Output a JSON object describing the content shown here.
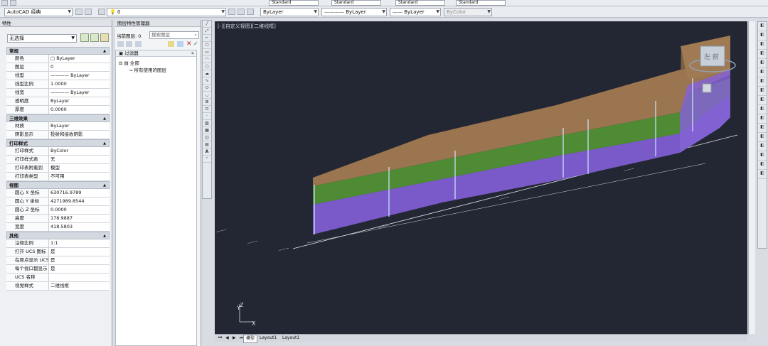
{
  "toolbar": {
    "workspace": "AutoCAD 经典",
    "layer_current": "0",
    "text_style": "Standard",
    "dim_style": "Standard",
    "table_style": "Standard",
    "multileader_style": "Standard",
    "color": "ByLayer",
    "linetype": "ByLayer",
    "lineweight": "ByLayer",
    "plotstyle": "ByColor"
  },
  "properties": {
    "title": "特性",
    "selection": "无选择",
    "sections": [
      {
        "name": "常规",
        "rows": [
          {
            "k": "颜色",
            "v": "□ ByLayer"
          },
          {
            "k": "图层",
            "v": "0"
          },
          {
            "k": "线型",
            "v": "———— ByLayer"
          },
          {
            "k": "线型比例",
            "v": "1.0000"
          },
          {
            "k": "线宽",
            "v": "———— ByLayer"
          },
          {
            "k": "透明度",
            "v": "ByLayer"
          },
          {
            "k": "厚度",
            "v": "0.0000"
          }
        ]
      },
      {
        "name": "三维效果",
        "rows": [
          {
            "k": "材质",
            "v": "ByLayer"
          },
          {
            "k": "阴影显示",
            "v": "投射和接收阴影"
          }
        ]
      },
      {
        "name": "打印样式",
        "rows": [
          {
            "k": "打印样式",
            "v": "ByColor"
          },
          {
            "k": "打印样式表",
            "v": "无"
          },
          {
            "k": "打印表附着到",
            "v": "模型"
          },
          {
            "k": "打印表类型",
            "v": "不可用"
          }
        ]
      },
      {
        "name": "视图",
        "rows": [
          {
            "k": "圆心 X 坐标",
            "v": "630716.9789"
          },
          {
            "k": "圆心 Y 坐标",
            "v": "4271989.8544"
          },
          {
            "k": "圆心 Z 坐标",
            "v": "0.0000"
          },
          {
            "k": "高度",
            "v": "178.9887"
          },
          {
            "k": "宽度",
            "v": "418.5803"
          }
        ]
      },
      {
        "name": "其他",
        "rows": [
          {
            "k": "注释比例",
            "v": "1:1"
          },
          {
            "k": "打开 UCS 图标",
            "v": "是"
          },
          {
            "k": "在原点显示 UCS ...",
            "v": "是"
          },
          {
            "k": "每个视口都显示 ...",
            "v": "是"
          },
          {
            "k": "UCS 名称",
            "v": ""
          },
          {
            "k": "视觉样式",
            "v": "二维线框"
          }
        ]
      }
    ]
  },
  "layer_manager": {
    "title": "图层特性管理器",
    "current_layer": "当前图层: 0",
    "search_placeholder": "搜索图层",
    "filters_label": "过滤器",
    "tree_all": "全部",
    "tree_used": "所有使用的图层"
  },
  "viewport": {
    "label": "[-][自定义视图][二维线框]",
    "cube_label": "左 前"
  },
  "layout_tabs": [
    "模型",
    "Layout1",
    "Layout1"
  ]
}
